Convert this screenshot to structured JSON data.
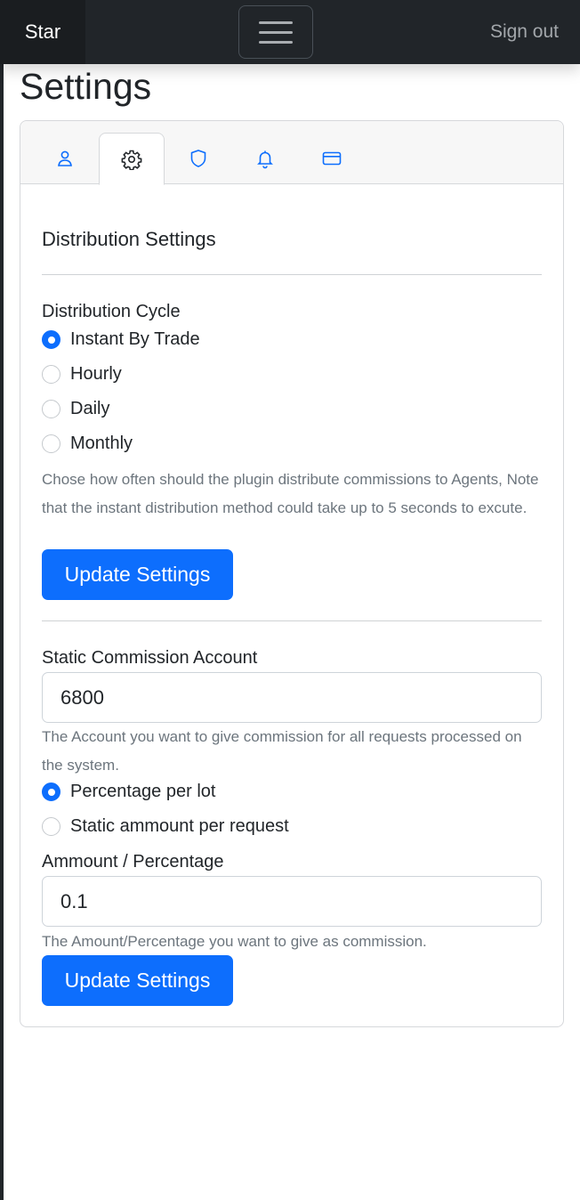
{
  "navbar": {
    "brand": "Star",
    "sign_out": "Sign out"
  },
  "page": {
    "title": "Settings"
  },
  "tabs": [
    {
      "icon": "person-icon",
      "active": false
    },
    {
      "icon": "gear-icon",
      "active": true
    },
    {
      "icon": "shield-icon",
      "active": false
    },
    {
      "icon": "bell-icon",
      "active": false
    },
    {
      "icon": "credit-card-icon",
      "active": false
    }
  ],
  "distribution": {
    "section_title": "Distribution Settings",
    "cycle_label": "Distribution Cycle",
    "options": [
      {
        "label": "Instant By Trade",
        "checked": true
      },
      {
        "label": "Hourly",
        "checked": false
      },
      {
        "label": "Daily",
        "checked": false
      },
      {
        "label": "Monthly",
        "checked": false
      }
    ],
    "help": "Chose how often should the plugin distribute commissions to Agents, Note that the instant distribution method could take up to 5 seconds to excute.",
    "button": "Update Settings"
  },
  "commission": {
    "account_label": "Static Commission Account",
    "account_value": "6800",
    "account_help": "The Account you want to give commission for all requests processed on the system.",
    "type_options": [
      {
        "label": "Percentage per lot",
        "checked": true
      },
      {
        "label": "Static ammount per request",
        "checked": false
      }
    ],
    "amount_label": "Ammount / Percentage",
    "amount_value": "0.1",
    "amount_help": "The Amount/Percentage you want to give as commission.",
    "button": "Update Settings"
  },
  "colors": {
    "primary": "#0d6efd",
    "navbar": "#212529"
  }
}
